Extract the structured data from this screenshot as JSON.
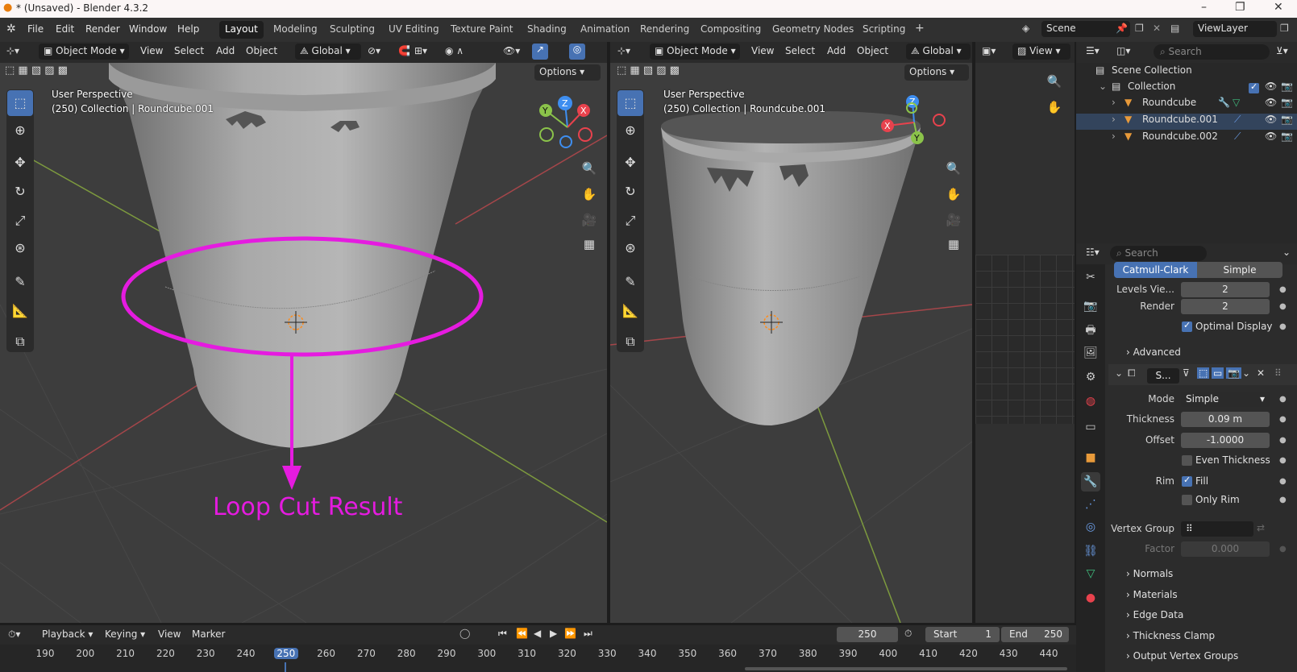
{
  "window": {
    "title": "* (Unsaved) - Blender 4.3.2",
    "minimize": "–",
    "maximize": "❐",
    "close": "✕"
  },
  "menu": [
    "File",
    "Edit",
    "Render",
    "Window",
    "Help"
  ],
  "workspaces": [
    "Layout",
    "Modeling",
    "Sculpting",
    "UV Editing",
    "Texture Paint",
    "Shading",
    "Animation",
    "Rendering",
    "Compositing",
    "Geometry Nodes",
    "Scripting"
  ],
  "add_workspace": "+",
  "scene": {
    "name": "Scene",
    "view_layer": "ViewLayer"
  },
  "viewport_left": {
    "mode": "Object Mode",
    "menus": [
      "View",
      "Select",
      "Add",
      "Object"
    ],
    "orientation": "Global",
    "options": "Options",
    "info_line1": "User Perspective",
    "info_line2": "(250) Collection | Roundcube.001"
  },
  "viewport_right": {
    "mode": "Object Mode",
    "menus": [
      "View",
      "Select",
      "Add",
      "Object"
    ],
    "orientation": "Global",
    "options": "Options",
    "info_line1": "User Perspective",
    "info_line2": "(250) Collection | Roundcube.001"
  },
  "image_editor": {
    "view": "View"
  },
  "annotation": {
    "label": "Loop Cut Result",
    "color": "#e51be0"
  },
  "gizmo": {
    "x": "X",
    "y": "Y",
    "z": "Z"
  },
  "outliner": {
    "search_placeholder": "Search",
    "scene_collection": "Scene Collection",
    "collection": "Collection",
    "objects": [
      "Roundcube",
      "Roundcube.001",
      "Roundcube.002"
    ]
  },
  "properties": {
    "search_placeholder": "Search",
    "subdiv": {
      "tab_catmull": "Catmull-Clark",
      "tab_simple": "Simple",
      "levels_label": "Levels Vie...",
      "levels": "2",
      "render_label": "Render",
      "render": "2",
      "optimal_display": "Optimal Display",
      "advanced": "Advanced"
    },
    "solidify": {
      "name": "S...",
      "mode_label": "Mode",
      "mode": "Simple",
      "thickness_label": "Thickness",
      "thickness": "0.09 m",
      "offset_label": "Offset",
      "offset": "-1.0000",
      "even_thickness": "Even Thickness",
      "rim_label": "Rim",
      "fill": "Fill",
      "only_rim": "Only Rim",
      "vertex_group_label": "Vertex Group",
      "factor_label": "Factor",
      "factor": "0.000"
    },
    "panels": [
      "Normals",
      "Materials",
      "Edge Data",
      "Thickness Clamp",
      "Output Vertex Groups"
    ]
  },
  "timeline": {
    "menus": [
      "Playback",
      "Keying",
      "View",
      "Marker"
    ],
    "current_frame": "250",
    "start_label": "Start",
    "start": "1",
    "end_label": "End",
    "end": "250",
    "ruler": [
      "190",
      "200",
      "210",
      "220",
      "230",
      "240",
      "250",
      "260",
      "270",
      "280",
      "290",
      "300",
      "310",
      "320",
      "330",
      "340",
      "350",
      "360",
      "370",
      "380",
      "390",
      "400",
      "410",
      "420",
      "430",
      "440"
    ]
  },
  "colors": {
    "accent": "#4772b3",
    "x_axis": "#e8424d",
    "y_axis": "#8bc34a",
    "z_axis": "#3e8ef0",
    "annotation": "#e51be0"
  }
}
